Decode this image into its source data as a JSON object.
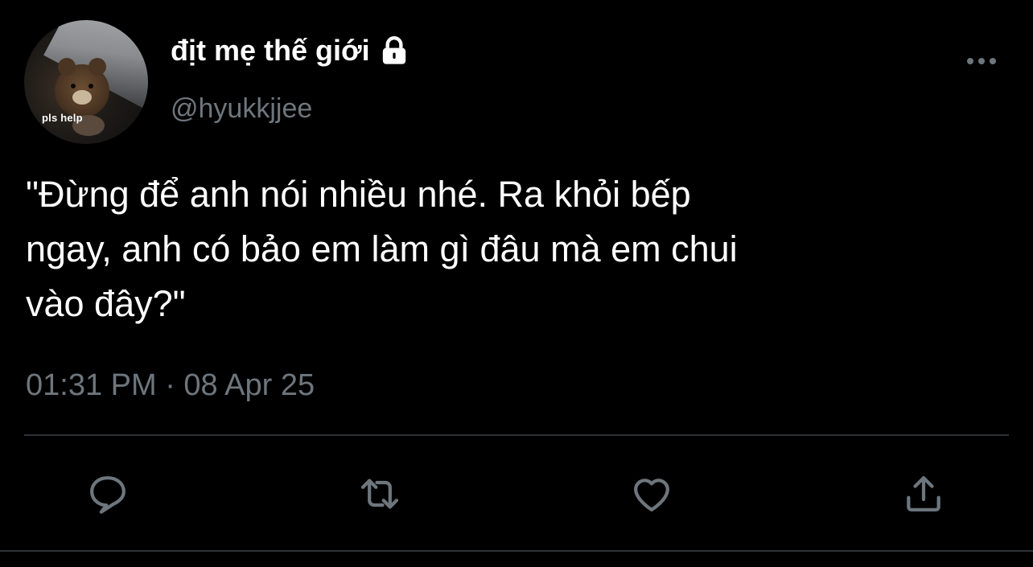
{
  "author": {
    "display_name": "địt mẹ thế giới",
    "handle": "@hyukkjjee",
    "avatar_caption": "pls help",
    "protected_icon": "lock-icon"
  },
  "tweet": {
    "text": "\"Đừng để anh nói nhiều nhé. Ra khỏi bếp\nngay, anh có bảo em làm gì đâu mà em chui\nvào đây?\"",
    "timestamp": "01:31 PM · 08 Apr 25"
  },
  "actions": [
    {
      "name": "reply",
      "icon": "reply-icon"
    },
    {
      "name": "retweet",
      "icon": "retweet-icon"
    },
    {
      "name": "like",
      "icon": "heart-icon"
    },
    {
      "name": "share",
      "icon": "share-icon"
    }
  ],
  "menu_icon": "more-icon",
  "colors": {
    "background": "#000000",
    "text_primary": "#ffffff",
    "text_secondary": "#6e767d",
    "divider": "#2f3336"
  }
}
